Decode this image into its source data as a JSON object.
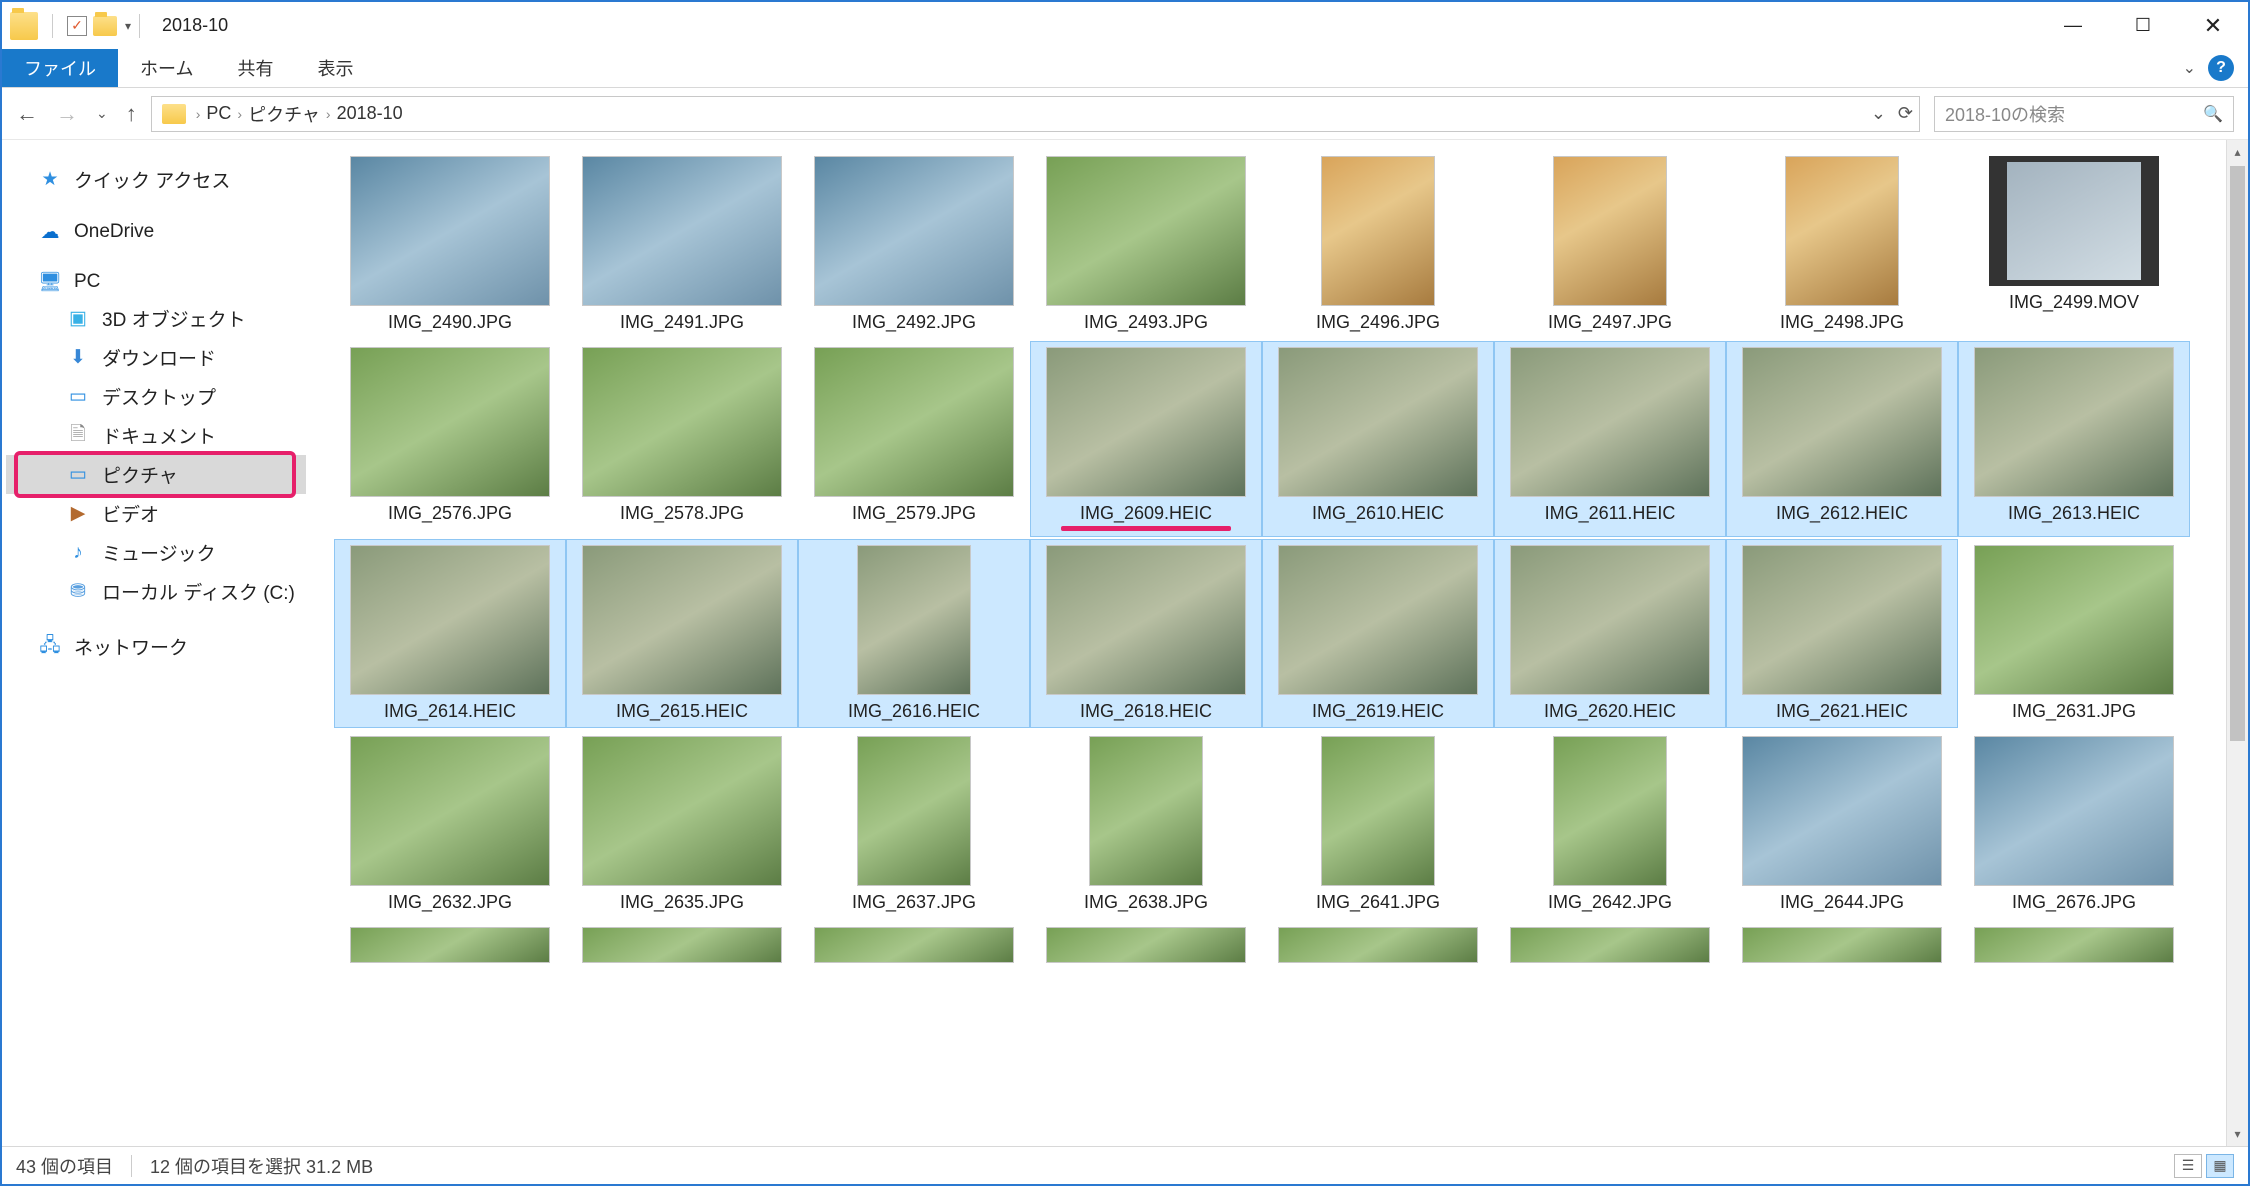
{
  "window": {
    "title": "2018-10",
    "minimize": "—",
    "maximize": "☐",
    "close": "✕"
  },
  "ribbon": {
    "file": "ファイル",
    "tabs": [
      "ホーム",
      "共有",
      "表示"
    ],
    "expand": "⌄",
    "help": "?"
  },
  "nav": {
    "back": "←",
    "forward": "→",
    "recent": "⌄",
    "up": "↑"
  },
  "breadcrumb": {
    "items": [
      "PC",
      "ピクチャ",
      "2018-10"
    ],
    "sep": "›",
    "dropdown": "⌄",
    "refresh": "⟳"
  },
  "search": {
    "placeholder": "2018-10の検索",
    "icon": "🔍"
  },
  "sidebar": {
    "quick_access": "クイック アクセス",
    "onedrive": "OneDrive",
    "pc": "PC",
    "pc_children": {
      "objects3d": "3D オブジェクト",
      "downloads": "ダウンロード",
      "desktop": "デスクトップ",
      "documents": "ドキュメント",
      "pictures": "ピクチャ",
      "videos": "ビデオ",
      "music": "ミュージック",
      "disk_c": "ローカル ディスク (C:)"
    },
    "network": "ネットワーク"
  },
  "files": [
    {
      "name": "IMG_2490.JPG",
      "sel": false,
      "shape": "land",
      "cls": "sky"
    },
    {
      "name": "IMG_2491.JPG",
      "sel": false,
      "shape": "land",
      "cls": "sky"
    },
    {
      "name": "IMG_2492.JPG",
      "sel": false,
      "shape": "land",
      "cls": "sky"
    },
    {
      "name": "IMG_2493.JPG",
      "sel": false,
      "shape": "land",
      "cls": "outdoor"
    },
    {
      "name": "IMG_2496.JPG",
      "sel": false,
      "shape": "port",
      "cls": "food"
    },
    {
      "name": "IMG_2497.JPG",
      "sel": false,
      "shape": "port",
      "cls": "food"
    },
    {
      "name": "IMG_2498.JPG",
      "sel": false,
      "shape": "port",
      "cls": "food"
    },
    {
      "name": "IMG_2499.MOV",
      "sel": false,
      "shape": "video",
      "cls": "video"
    },
    {
      "name": "IMG_2576.JPG",
      "sel": false,
      "shape": "land",
      "cls": "outdoor"
    },
    {
      "name": "IMG_2578.JPG",
      "sel": false,
      "shape": "land",
      "cls": "outdoor"
    },
    {
      "name": "IMG_2579.JPG",
      "sel": false,
      "shape": "land",
      "cls": "outdoor"
    },
    {
      "name": "IMG_2609.HEIC",
      "sel": true,
      "shape": "land",
      "cls": "temple",
      "underline": true
    },
    {
      "name": "IMG_2610.HEIC",
      "sel": true,
      "shape": "land",
      "cls": "temple"
    },
    {
      "name": "IMG_2611.HEIC",
      "sel": true,
      "shape": "land",
      "cls": "temple"
    },
    {
      "name": "IMG_2612.HEIC",
      "sel": true,
      "shape": "land",
      "cls": "temple"
    },
    {
      "name": "IMG_2613.HEIC",
      "sel": true,
      "shape": "land",
      "cls": "temple"
    },
    {
      "name": "IMG_2614.HEIC",
      "sel": true,
      "shape": "land",
      "cls": "temple"
    },
    {
      "name": "IMG_2615.HEIC",
      "sel": true,
      "shape": "land",
      "cls": "temple"
    },
    {
      "name": "IMG_2616.HEIC",
      "sel": true,
      "shape": "port",
      "cls": "temple"
    },
    {
      "name": "IMG_2618.HEIC",
      "sel": true,
      "shape": "land",
      "cls": "temple"
    },
    {
      "name": "IMG_2619.HEIC",
      "sel": true,
      "shape": "land",
      "cls": "temple"
    },
    {
      "name": "IMG_2620.HEIC",
      "sel": true,
      "shape": "land",
      "cls": "temple"
    },
    {
      "name": "IMG_2621.HEIC",
      "sel": true,
      "shape": "land",
      "cls": "temple"
    },
    {
      "name": "IMG_2631.JPG",
      "sel": false,
      "shape": "land",
      "cls": "outdoor"
    },
    {
      "name": "IMG_2632.JPG",
      "sel": false,
      "shape": "land",
      "cls": "outdoor"
    },
    {
      "name": "IMG_2635.JPG",
      "sel": false,
      "shape": "land",
      "cls": "outdoor"
    },
    {
      "name": "IMG_2637.JPG",
      "sel": false,
      "shape": "port",
      "cls": "outdoor"
    },
    {
      "name": "IMG_2638.JPG",
      "sel": false,
      "shape": "port",
      "cls": "outdoor"
    },
    {
      "name": "IMG_2641.JPG",
      "sel": false,
      "shape": "port",
      "cls": "outdoor"
    },
    {
      "name": "IMG_2642.JPG",
      "sel": false,
      "shape": "port",
      "cls": "outdoor"
    },
    {
      "name": "IMG_2644.JPG",
      "sel": false,
      "shape": "land",
      "cls": "sky"
    },
    {
      "name": "IMG_2676.JPG",
      "sel": false,
      "shape": "land",
      "cls": "sky"
    }
  ],
  "partial_row": [
    {
      "shape": "land"
    },
    {
      "shape": "land"
    },
    {
      "shape": "land"
    },
    {
      "shape": "land"
    },
    {
      "shape": "land"
    },
    {
      "shape": "land"
    },
    {
      "shape": "land"
    },
    {
      "shape": "land"
    }
  ],
  "status": {
    "count": "43 個の項目",
    "selection": "12 個の項目を選択 31.2 MB"
  }
}
